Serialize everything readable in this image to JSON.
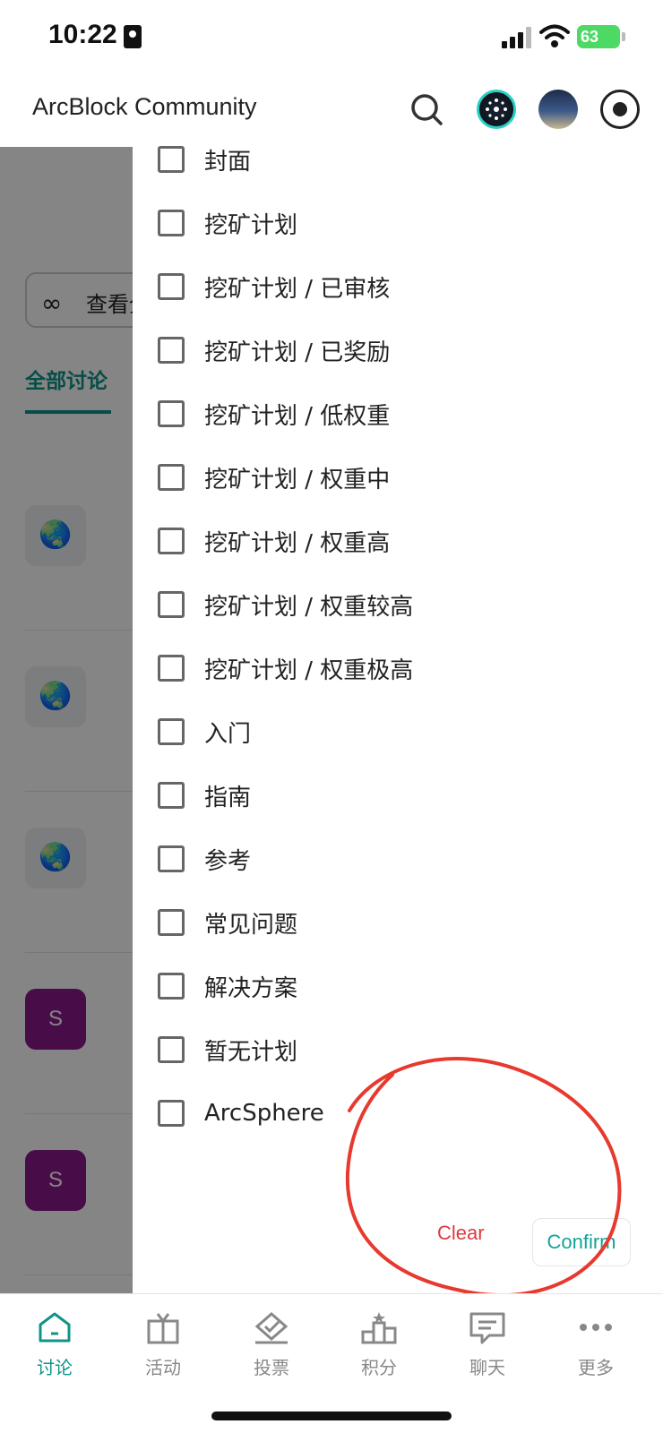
{
  "status_bar": {
    "time": "10:22",
    "battery": "63"
  },
  "header": {
    "title": "ArcBlock Community"
  },
  "background": {
    "view_all_label": "查看全",
    "tab_label": "全部讨论",
    "rows": [
      {
        "avatar": "🌏"
      },
      {
        "avatar": "🌏"
      },
      {
        "avatar": "🌏"
      },
      {
        "avatar": "S"
      },
      {
        "avatar": "S"
      }
    ]
  },
  "filter_drawer": {
    "options": [
      {
        "label": "封面",
        "checked": false
      },
      {
        "label": "挖矿计划",
        "checked": false
      },
      {
        "label": "挖矿计划 / 已审核",
        "checked": false
      },
      {
        "label": "挖矿计划 / 已奖励",
        "checked": false
      },
      {
        "label": "挖矿计划 / 低权重",
        "checked": false
      },
      {
        "label": "挖矿计划 / 权重中",
        "checked": false
      },
      {
        "label": "挖矿计划 / 权重高",
        "checked": false
      },
      {
        "label": "挖矿计划 / 权重较高",
        "checked": false
      },
      {
        "label": "挖矿计划 / 权重极高",
        "checked": false
      },
      {
        "label": "入门",
        "checked": false
      },
      {
        "label": "指南",
        "checked": false
      },
      {
        "label": "参考",
        "checked": false
      },
      {
        "label": "常见问题",
        "checked": false
      },
      {
        "label": "解决方案",
        "checked": false
      },
      {
        "label": "暂无计划",
        "checked": false
      },
      {
        "label": "ArcSphere",
        "checked": false
      }
    ],
    "clear_label": "Clear",
    "confirm_label": "Confirm"
  },
  "bottom_nav": {
    "items": [
      {
        "label": "讨论",
        "icon": "home-icon",
        "active": true
      },
      {
        "label": "活动",
        "icon": "gift-icon",
        "active": false
      },
      {
        "label": "投票",
        "icon": "vote-icon",
        "active": false
      },
      {
        "label": "积分",
        "icon": "leaderboard-icon",
        "active": false
      },
      {
        "label": "聊天",
        "icon": "chat-icon",
        "active": false
      },
      {
        "label": "更多",
        "icon": "more-icon",
        "active": false
      }
    ]
  },
  "colors": {
    "accent": "#0f9488",
    "clear": "#e0393e",
    "confirm": "#14a39a",
    "annotation": "#e8392f"
  }
}
